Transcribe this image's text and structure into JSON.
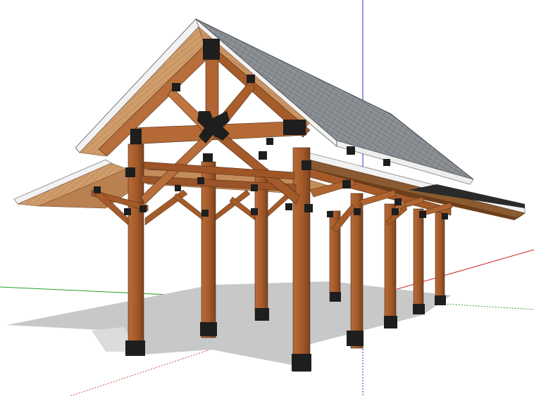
{
  "app": {
    "view": "3d-model-viewport"
  },
  "scene": {
    "subject": "timber-frame-pavilion",
    "axes": {
      "red": "#d02020",
      "green": "#20a020",
      "blue": "#2020d0"
    },
    "colors": {
      "timber": "#a0582a",
      "timber_light": "#c27a45",
      "timber_dark": "#6e3a19",
      "soffit": "#d2a070",
      "roof_shingle": "#8a8f94",
      "fascia": "#f2f2f2",
      "bracket": "#222222",
      "shadow": "#c9c9c9"
    }
  }
}
